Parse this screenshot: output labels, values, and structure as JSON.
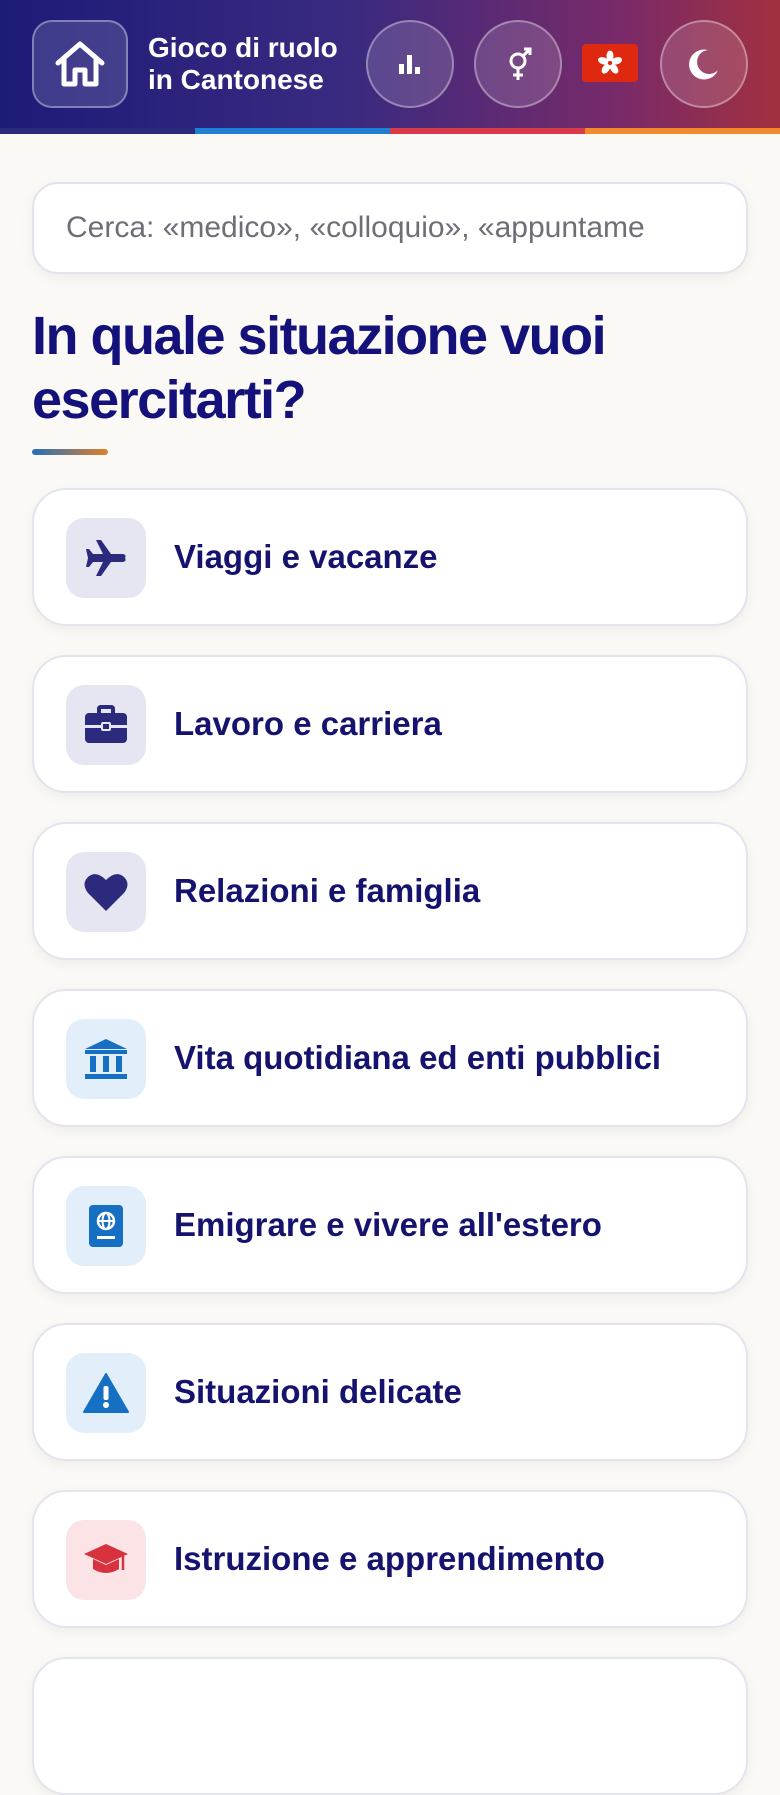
{
  "header": {
    "title_line1": "Gioco di ruolo",
    "title_line2": "in Cantonese",
    "buttons": [
      "home-icon",
      "stats-icon",
      "gender-icon",
      "flag-hk-icon",
      "moon-icon"
    ],
    "stripe_colors": [
      "#2a2a7a",
      "#1f7fd0",
      "#d83a4a",
      "#f08a2a"
    ]
  },
  "search": {
    "placeholder": "Cerca: «medico», «colloquio», «appuntame"
  },
  "main": {
    "heading": "In quale situazione vuoi esercitarti?"
  },
  "categories": [
    {
      "label": "Viaggi e vacanze",
      "icon": "airplane-icon",
      "icon_color": "#2b2a7c",
      "icon_bg": "#e6e6f2"
    },
    {
      "label": "Lavoro e carriera",
      "icon": "briefcase-icon",
      "icon_color": "#2b2a7c",
      "icon_bg": "#e6e6f2"
    },
    {
      "label": "Relazioni e famiglia",
      "icon": "heart-icon",
      "icon_color": "#2b2a7c",
      "icon_bg": "#e6e6f2"
    },
    {
      "label": "Vita quotidiana ed enti pubblici",
      "icon": "bank-icon",
      "icon_color": "#1570c4",
      "icon_bg": "#e2eef9"
    },
    {
      "label": "Emigrare e vivere all'estero",
      "icon": "passport-icon",
      "icon_color": "#1570c4",
      "icon_bg": "#e2eef9"
    },
    {
      "label": "Situazioni delicate",
      "icon": "warning-icon",
      "icon_color": "#1570c4",
      "icon_bg": "#e2eef9"
    },
    {
      "label": "Istruzione e apprendimento",
      "icon": "graduation-cap-icon",
      "icon_color": "#d8323e",
      "icon_bg": "#fbe3e6"
    }
  ]
}
